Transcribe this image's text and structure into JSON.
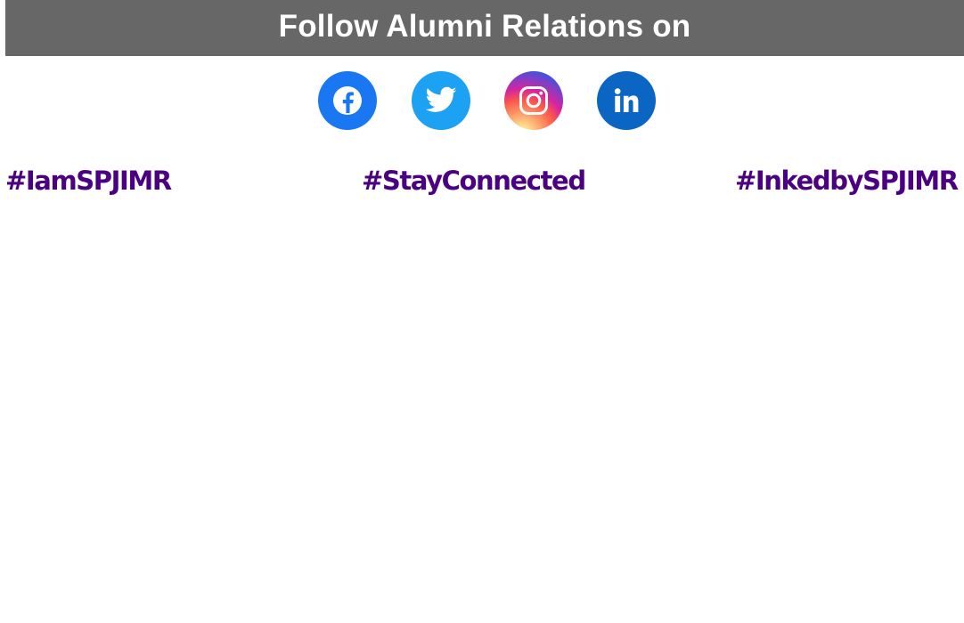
{
  "banner": {
    "title": "Follow Alumni Relations on"
  },
  "social": [
    {
      "name": "facebook",
      "icon": "facebook-icon",
      "color": "#1a77f2"
    },
    {
      "name": "twitter",
      "icon": "twitter-icon",
      "color": "#1da1f2"
    },
    {
      "name": "instagram",
      "icon": "instagram-icon",
      "color": "#d6249f"
    },
    {
      "name": "linkedin",
      "icon": "linkedin-icon",
      "color": "#0a66c2"
    }
  ],
  "hashtags": [
    "#IamSPJIMR",
    "#StayConnected",
    "#InkedbySPJIMR"
  ],
  "colors": {
    "banner_bg": "#676767",
    "hashtag": "#4b0082"
  }
}
